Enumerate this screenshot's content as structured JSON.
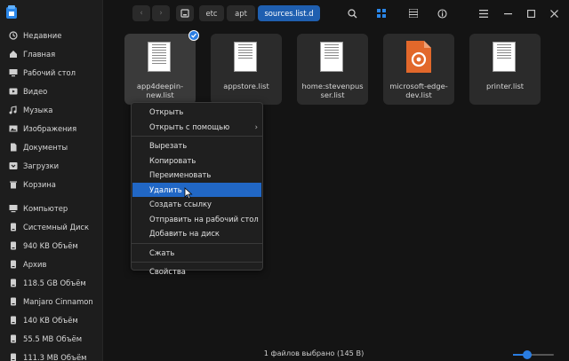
{
  "app": {
    "icon": "file-manager-icon"
  },
  "sidebar": {
    "groups": [
      [
        {
          "label": "Недавние",
          "icon": "recent-icon"
        },
        {
          "label": "Главная",
          "icon": "home-icon"
        },
        {
          "label": "Рабочий стол",
          "icon": "desktop-icon"
        },
        {
          "label": "Видео",
          "icon": "video-icon"
        },
        {
          "label": "Музыка",
          "icon": "music-icon"
        },
        {
          "label": "Изображения",
          "icon": "pictures-icon"
        },
        {
          "label": "Документы",
          "icon": "documents-icon"
        },
        {
          "label": "Загрузки",
          "icon": "downloads-icon"
        },
        {
          "label": "Корзина",
          "icon": "trash-icon"
        }
      ],
      [
        {
          "label": "Компьютер",
          "icon": "computer-icon"
        },
        {
          "label": "Системный Диск",
          "icon": "drive-icon"
        },
        {
          "label": "940 KB Объём",
          "icon": "drive-icon"
        },
        {
          "label": "Архив",
          "icon": "drive-icon"
        },
        {
          "label": "118.5 GB Объём",
          "icon": "drive-icon"
        },
        {
          "label": "Manjaro Cinnamon",
          "icon": "drive-icon"
        },
        {
          "label": "140 KB Объём",
          "icon": "drive-icon"
        },
        {
          "label": "55.5 MB Объём",
          "icon": "drive-icon"
        },
        {
          "label": "111.3 MB Объём",
          "icon": "drive-icon"
        }
      ]
    ]
  },
  "toolbar": {
    "breadcrumbs": [
      "etc",
      "apt",
      "sources.list.d"
    ],
    "tools": [
      "search-icon",
      "icon-view-icon",
      "list-view-icon",
      "details-icon",
      "menu-icon",
      "minimize-icon",
      "maximize-icon",
      "close-icon"
    ]
  },
  "files": [
    {
      "name": "app4deepin-new.list",
      "line1": "app4deepin-",
      "line2": "new.list",
      "selected": true
    },
    {
      "name": "appstore.list",
      "line1": "appstore.list",
      "line2": ""
    },
    {
      "name": "home:stevenpusser.list",
      "line1": "home:stevenpus",
      "line2": "ser.list"
    },
    {
      "name": "microsoft-edge-dev.list",
      "line1": "microsoft-edge-",
      "line2": "dev.list",
      "icon": "microsoft-package-icon"
    },
    {
      "name": "printer.list",
      "line1": "printer.list",
      "line2": ""
    }
  ],
  "context_menu": {
    "items": [
      {
        "label": "Открыть"
      },
      {
        "label": "Открыть с помощью",
        "submenu": true
      },
      {
        "sep": true
      },
      {
        "label": "Вырезать"
      },
      {
        "label": "Копировать"
      },
      {
        "label": "Переименовать"
      },
      {
        "label": "Удалить",
        "highlighted": true
      },
      {
        "label": "Создать ссылку"
      },
      {
        "label": "Отправить на рабочий стол"
      },
      {
        "label": "Добавить на диск"
      },
      {
        "sep": true
      },
      {
        "label": "Сжать"
      },
      {
        "sep": true
      },
      {
        "label": "Свойства"
      }
    ]
  },
  "status": {
    "text": "1 файлов выбрано (145 B)",
    "zoom_fraction": 0.35
  },
  "colors": {
    "accent": "#2167c5",
    "background": "#141414"
  }
}
